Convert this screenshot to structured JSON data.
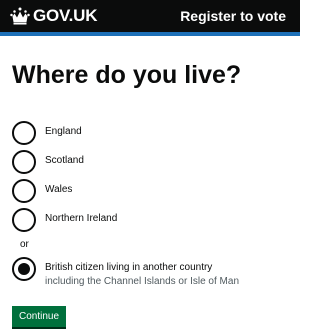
{
  "header": {
    "logo_text": "GOV.UK",
    "service_name": "Register to vote",
    "crown_icon": "crown-icon",
    "background_color": "#0b0c0c",
    "accent_color": "#1d70b8"
  },
  "question": {
    "heading": "Where do you live?"
  },
  "options": [
    {
      "label": "England",
      "checked": false
    },
    {
      "label": "Scotland",
      "checked": false
    },
    {
      "label": "Wales",
      "checked": false
    },
    {
      "label": "Northern Ireland",
      "checked": false
    },
    {
      "label": "British citizen living in another country",
      "hint": "including the Channel Islands or Isle of Man",
      "checked": true
    }
  ],
  "divider_text": "or",
  "continue_button": {
    "label": "Continue",
    "color": "#00703c"
  }
}
